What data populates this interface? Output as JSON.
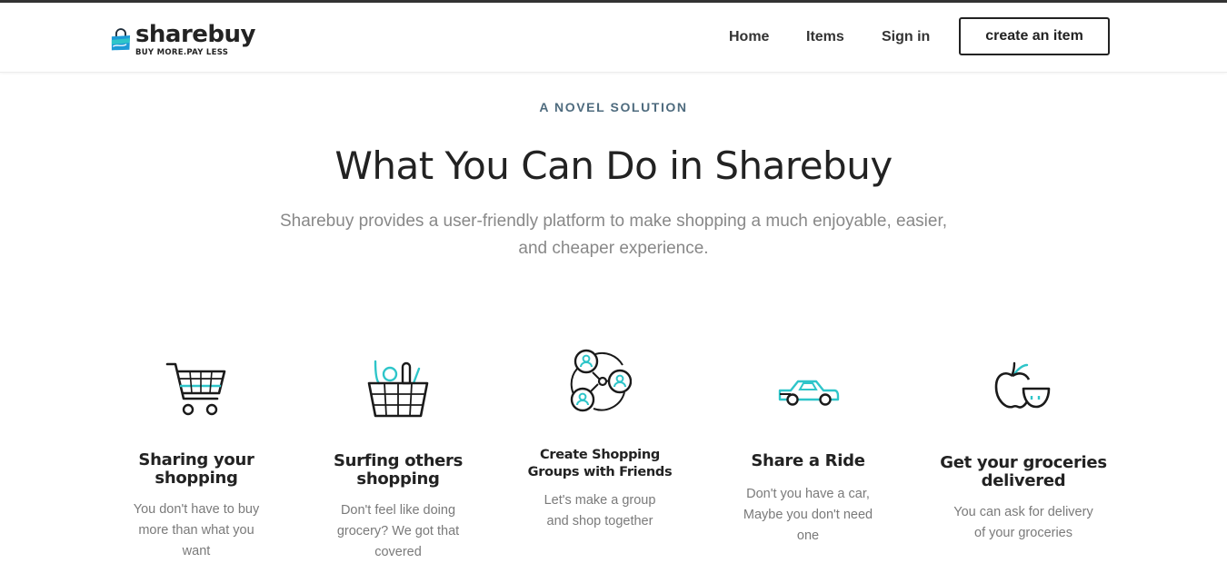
{
  "header": {
    "logo": {
      "name": "sharebuy",
      "tagline": "BUY MORE.PAY LESS",
      "icon": "shopping-bag-icon"
    },
    "nav": [
      {
        "label": "Home"
      },
      {
        "label": "Items"
      },
      {
        "label": "Sign in"
      }
    ],
    "cta_label": "create an item"
  },
  "section": {
    "eyebrow": "A NOVEL SOLUTION",
    "title": "What You Can Do in Sharebuy",
    "subtitle_line1": "Sharebuy provides a user-friendly platform to make shopping a much enjoyable, easier,",
    "subtitle_line2": "and cheaper experience."
  },
  "features": [
    {
      "icon": "shopping-cart-icon",
      "title_line1": "Sharing your",
      "title_line2": "shopping",
      "desc_line1": "You don't have to buy",
      "desc_line2": "more than what you",
      "desc_line3": "want"
    },
    {
      "icon": "grocery-basket-icon",
      "title_line1": "Surfing others",
      "title_line2": "shopping",
      "desc_line1": "Don't feel like doing",
      "desc_line2": "grocery? We got that",
      "desc_line3": "covered"
    },
    {
      "icon": "group-network-icon",
      "title_line1": "Create Shopping",
      "title_line2": "Groups with Friends",
      "desc_line1": "Let's make a group",
      "desc_line2": "and shop together"
    },
    {
      "icon": "car-icon",
      "title_line1": "Share a Ride",
      "desc_line1": "Don't you have a car,",
      "desc_line2": "Maybe you don't need",
      "desc_line3": "one"
    },
    {
      "icon": "apple-groceries-icon",
      "title_line1": "Get your groceries",
      "title_line2": "delivered",
      "desc_line1": "You can ask for delivery",
      "desc_line2": "of your groceries"
    }
  ],
  "colors": {
    "accent": "#2ec5c9",
    "brand_blue": "#1d9ad6",
    "text_dark": "#222222",
    "text_muted": "#888888",
    "eyebrow": "#4e6b7e"
  }
}
